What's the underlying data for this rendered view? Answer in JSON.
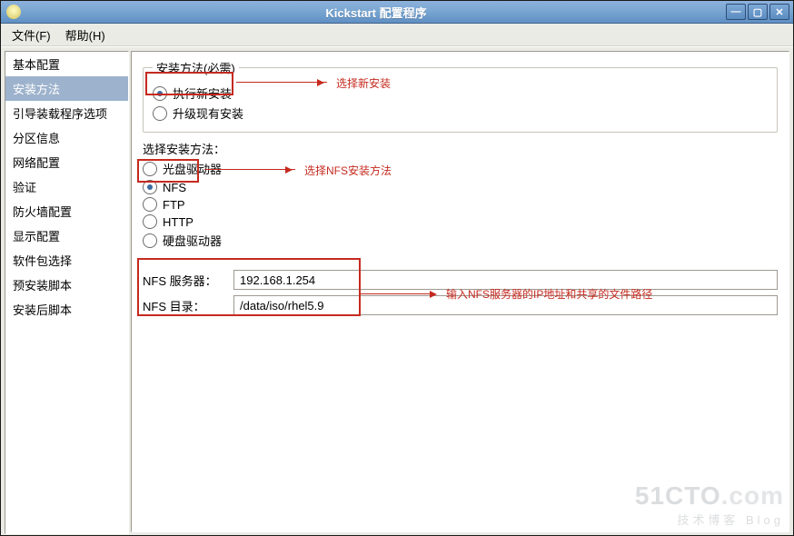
{
  "window": {
    "title": "Kickstart 配置程序"
  },
  "menu": {
    "file": "文件(F)",
    "help": "帮助(H)"
  },
  "sidebar": {
    "items": [
      {
        "label": "基本配置"
      },
      {
        "label": "安装方法"
      },
      {
        "label": "引导装载程序选项"
      },
      {
        "label": "分区信息"
      },
      {
        "label": "网络配置"
      },
      {
        "label": "验证"
      },
      {
        "label": "防火墙配置"
      },
      {
        "label": "显示配置"
      },
      {
        "label": "软件包选择"
      },
      {
        "label": "预安装脚本"
      },
      {
        "label": "安装后脚本"
      }
    ],
    "selected_index": 1
  },
  "main": {
    "group_title": "安装方法(必需)",
    "install_type": {
      "new": "执行新安装",
      "upgrade": "升级现有安装",
      "selected": "new"
    },
    "method_heading": "选择安装方法：",
    "methods": {
      "cd": "光盘驱动器",
      "nfs": "NFS",
      "ftp": "FTP",
      "http": "HTTP",
      "hd": "硬盘驱动器",
      "selected": "nfs"
    },
    "nfs": {
      "server_label": "NFS 服务器：",
      "server_value": "192.168.1.254",
      "dir_label": "NFS 目录：",
      "dir_value": "/data/iso/rhel5.9"
    }
  },
  "annotations": {
    "a1": "选择新安装",
    "a2": "选择NFS安装方法",
    "a3": "输入NFS服务器的IP地址和共享的文件路径"
  },
  "watermark": {
    "l1a": "51CTO",
    "l1b": ".com",
    "l2": "技术博客   Blog"
  }
}
